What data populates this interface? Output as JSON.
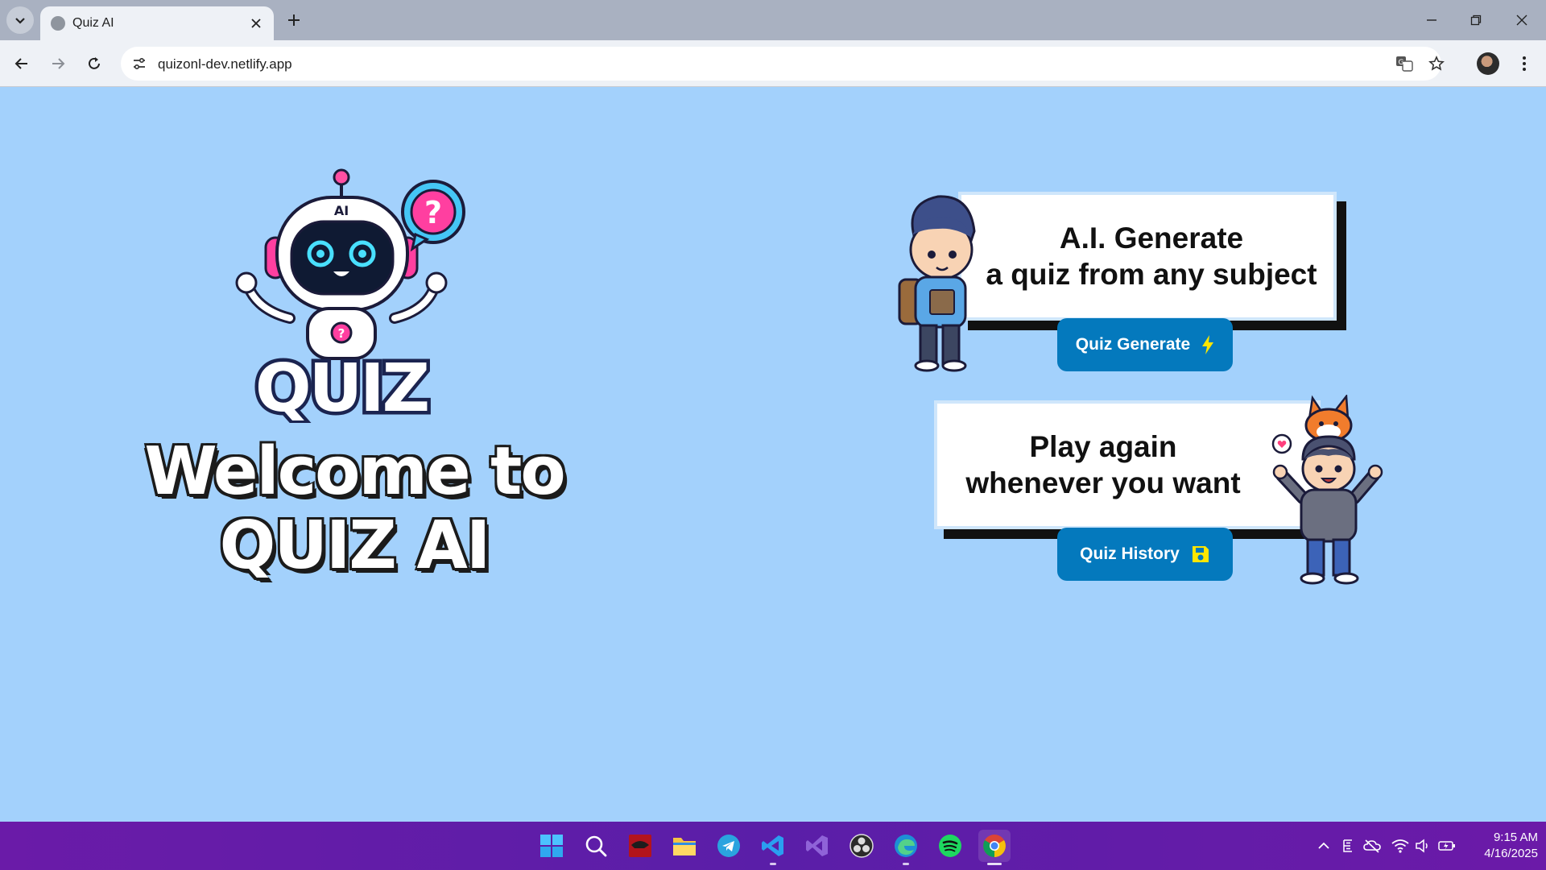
{
  "browser": {
    "tab_title": "Quiz AI",
    "url": "quizonl-dev.netlify.app"
  },
  "page": {
    "logo_text": "QUIZ",
    "logo_badge": "AI",
    "welcome_line1": "Welcome to",
    "welcome_line2": "QUIZ AI",
    "card1_line1": "A.I. Generate",
    "card1_line2": "a quiz from any subject",
    "card2_line1": "Play again",
    "card2_line2": "whenever you want",
    "generate_button_label": "Quiz Generate",
    "history_button_label": "Quiz History"
  },
  "taskbar": {
    "time": "9:15 AM",
    "date": "4/16/2025",
    "apps": [
      "start-icon",
      "search-icon",
      "app-icon",
      "file-explorer-icon",
      "telegram-icon",
      "vscode-icon",
      "visual-studio-icon",
      "obs-icon",
      "edge-icon",
      "spotify-icon",
      "chrome-icon"
    ]
  },
  "colors": {
    "page_background": "#a3d1fc",
    "button_blue": "#0479bd",
    "icon_yellow": "#ffe600",
    "taskbar_purple": "#6a1ba8"
  }
}
